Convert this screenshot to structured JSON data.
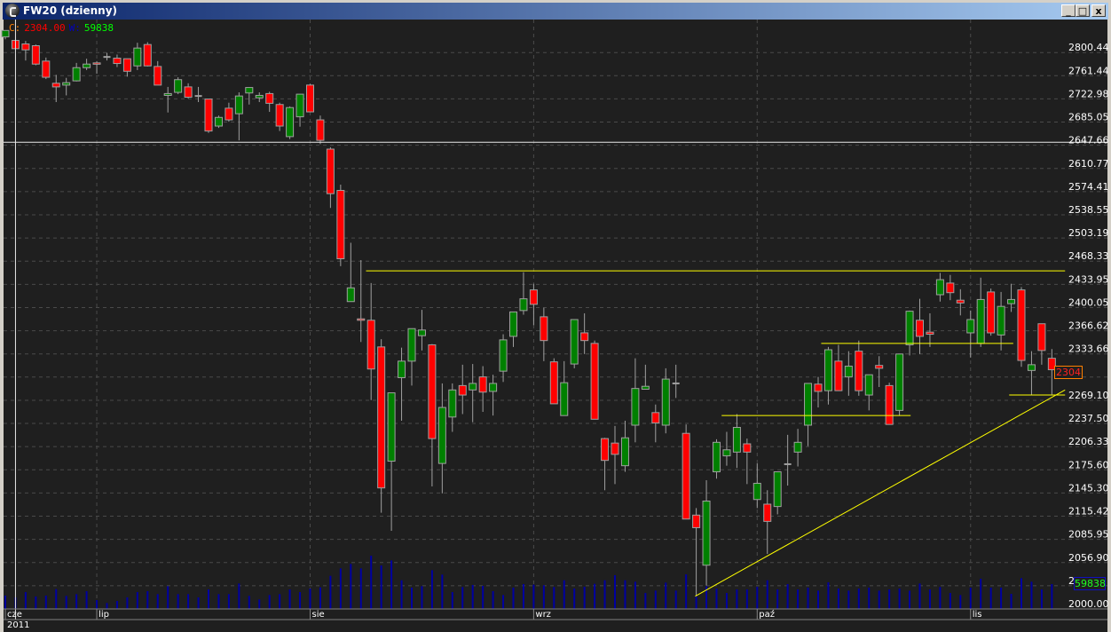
{
  "window": {
    "title": "FW20 (dzienny)",
    "minimize": "_",
    "maximize": "□",
    "close": "x"
  },
  "legend": {
    "c_label": "C:",
    "close": "2304.00",
    "w_label": "W:",
    "volume": "59838"
  },
  "tags": {
    "price": "2304",
    "volume": "59838"
  },
  "colors": {
    "up": "#008000",
    "down": "#ff0000",
    "doji": "#a0a0a0",
    "volume": "#0000a0",
    "annotation": "#ffff00",
    "legend_c": "#ff8000",
    "legend_close": "#ff0000",
    "legend_w": "#0000c0",
    "legend_volume": "#00ff00"
  },
  "x_axis": {
    "year": "2011",
    "months": [
      {
        "label": "cze",
        "index": 0
      },
      {
        "label": "lip",
        "index": 9
      },
      {
        "label": "sie",
        "index": 30
      },
      {
        "label": "wrz",
        "index": 52
      },
      {
        "label": "paź",
        "index": 74
      },
      {
        "label": "lis",
        "index": 95
      }
    ]
  },
  "chart_data": {
    "type": "candlestick",
    "title": "FW20 (dzienny)",
    "y_scale": "log",
    "ylim": [
      2000,
      2800.44
    ],
    "grid": true,
    "y_ticks": [
      {
        "label": "2800.44",
        "value": 2800.44
      },
      {
        "label": "2761.44",
        "value": 2761.44
      },
      {
        "label": "2722.98",
        "value": 2722.98
      },
      {
        "label": "2685.05",
        "value": 2685.05
      },
      {
        "label": "2647.66",
        "value": 2647.66
      },
      {
        "label": "2610.77",
        "value": 2610.77
      },
      {
        "label": "2574.41",
        "value": 2574.41
      },
      {
        "label": "2538.55",
        "value": 2538.55
      },
      {
        "label": "2503.19",
        "value": 2503.19
      },
      {
        "label": "2468.33",
        "value": 2468.33
      },
      {
        "label": "2433.95",
        "value": 2433.95
      },
      {
        "label": "2400.05",
        "value": 2400.05
      },
      {
        "label": "2366.62",
        "value": 2366.62
      },
      {
        "label": "2333.66",
        "value": 2333.66
      },
      {
        "label": "23",
        "value": 2301.2
      },
      {
        "label": "2269.10",
        "value": 2269.1
      },
      {
        "label": "2237.50",
        "value": 2237.5
      },
      {
        "label": "2206.33",
        "value": 2206.33
      },
      {
        "label": "2175.60",
        "value": 2175.6
      },
      {
        "label": "2145.30",
        "value": 2145.3
      },
      {
        "label": "2115.42",
        "value": 2115.42
      },
      {
        "label": "2085.95",
        "value": 2085.95
      },
      {
        "label": "2056.90",
        "value": 2056.9
      },
      {
        "label": "20",
        "value": 2028.3
      },
      {
        "label": "2000.00",
        "value": 2000.0
      }
    ],
    "candles_ohlc": [
      [
        2818,
        2829,
        2814,
        2829
      ],
      [
        2812,
        2812,
        2796,
        2798
      ],
      [
        2806,
        2811,
        2778,
        2796
      ],
      [
        2803,
        2805,
        2770,
        2772
      ],
      [
        2777,
        2783,
        2747,
        2750
      ],
      [
        2740,
        2754,
        2709,
        2734
      ],
      [
        2737,
        2749,
        2720,
        2741
      ],
      [
        2744,
        2774,
        2743,
        2766
      ],
      [
        2766,
        2781,
        2762,
        2772
      ],
      [
        2774,
        2777,
        2756,
        2773
      ],
      [
        2784,
        2791,
        2778,
        2784
      ],
      [
        2782,
        2788,
        2767,
        2773
      ],
      [
        2781,
        2781,
        2751,
        2760
      ],
      [
        2769,
        2808,
        2762,
        2799
      ],
      [
        2805,
        2809,
        2768,
        2769
      ],
      [
        2768,
        2777,
        2737,
        2737
      ],
      [
        2720,
        2734,
        2692,
        2723
      ],
      [
        2725,
        2750,
        2722,
        2746
      ],
      [
        2734,
        2740,
        2715,
        2717
      ],
      [
        2719,
        2734,
        2709,
        2719
      ],
      [
        2714,
        2714,
        2659,
        2662
      ],
      [
        2670,
        2687,
        2667,
        2684
      ],
      [
        2699,
        2708,
        2677,
        2680
      ],
      [
        2690,
        2725,
        2647,
        2719
      ],
      [
        2724,
        2733,
        2705,
        2733
      ],
      [
        2716,
        2725,
        2709,
        2720
      ],
      [
        2723,
        2726,
        2693,
        2707
      ],
      [
        2705,
        2708,
        2662,
        2670
      ],
      [
        2653,
        2702,
        2649,
        2700
      ],
      [
        2685,
        2722,
        2669,
        2722
      ],
      [
        2737,
        2739,
        2693,
        2693
      ],
      [
        2680,
        2687,
        2641,
        2647
      ],
      [
        2633,
        2636,
        2541,
        2563
      ],
      [
        2568,
        2577,
        2453,
        2464
      ],
      [
        2401,
        2488,
        2401,
        2421
      ],
      [
        2376,
        2462,
        2343,
        2374
      ],
      [
        2374,
        2428,
        2262,
        2305
      ],
      [
        2336,
        2347,
        2113,
        2145
      ],
      [
        2180,
        2272,
        2090,
        2272
      ],
      [
        2293,
        2335,
        2234,
        2316
      ],
      [
        2316,
        2362,
        2282,
        2362
      ],
      [
        2352,
        2389,
        2331,
        2360
      ],
      [
        2339,
        2340,
        2147,
        2210
      ],
      [
        2177,
        2285,
        2138,
        2252
      ],
      [
        2239,
        2285,
        2219,
        2276
      ],
      [
        2282,
        2311,
        2243,
        2269
      ],
      [
        2276,
        2312,
        2232,
        2285
      ],
      [
        2294,
        2309,
        2246,
        2273
      ],
      [
        2274,
        2297,
        2241,
        2285
      ],
      [
        2302,
        2354,
        2287,
        2346
      ],
      [
        2351,
        2386,
        2336,
        2386
      ],
      [
        2388,
        2444,
        2382,
        2405
      ],
      [
        2418,
        2427,
        2367,
        2397
      ],
      [
        2379,
        2392,
        2316,
        2345
      ],
      [
        2315,
        2320,
        2257,
        2257
      ],
      [
        2241,
        2316,
        2241,
        2286
      ],
      [
        2312,
        2375,
        2306,
        2375
      ],
      [
        2356,
        2384,
        2326,
        2345
      ],
      [
        2341,
        2345,
        2236,
        2236
      ],
      [
        2210,
        2211,
        2142,
        2181
      ],
      [
        2204,
        2227,
        2150,
        2189
      ],
      [
        2174,
        2234,
        2166,
        2211
      ],
      [
        2228,
        2320,
        2205,
        2278
      ],
      [
        2277,
        2311,
        2277,
        2281
      ],
      [
        2245,
        2256,
        2205,
        2231
      ],
      [
        2228,
        2306,
        2217,
        2291
      ],
      [
        2285,
        2311,
        2265,
        2285
      ],
      [
        2217,
        2229,
        2105,
        2105
      ],
      [
        2110,
        2119,
        2009,
        2094
      ],
      [
        2047,
        2155,
        2022,
        2128
      ],
      [
        2166,
        2209,
        2157,
        2205
      ],
      [
        2187,
        2219,
        2174,
        2195
      ],
      [
        2192,
        2243,
        2171,
        2225
      ],
      [
        2203,
        2210,
        2150,
        2192
      ],
      [
        2130,
        2177,
        2119,
        2151
      ],
      [
        2124,
        2142,
        2061,
        2102
      ],
      [
        2121,
        2166,
        2111,
        2166
      ],
      [
        2176,
        2215,
        2148,
        2176
      ],
      [
        2192,
        2223,
        2173,
        2205
      ],
      [
        2228,
        2285,
        2200,
        2285
      ],
      [
        2284,
        2294,
        2252,
        2274
      ],
      [
        2275,
        2336,
        2256,
        2332
      ],
      [
        2316,
        2339,
        2275,
        2275
      ],
      [
        2294,
        2330,
        2268,
        2309
      ],
      [
        2330,
        2345,
        2268,
        2275
      ],
      [
        2269,
        2297,
        2248,
        2297
      ],
      [
        2310,
        2323,
        2280,
        2306
      ],
      [
        2282,
        2286,
        2229,
        2229
      ],
      [
        2248,
        2326,
        2241,
        2326
      ],
      [
        2339,
        2388,
        2324,
        2387
      ],
      [
        2374,
        2405,
        2326,
        2351
      ],
      [
        2357,
        2384,
        2336,
        2354
      ],
      [
        2411,
        2443,
        2401,
        2433
      ],
      [
        2428,
        2440,
        2403,
        2414
      ],
      [
        2403,
        2419,
        2381,
        2399
      ],
      [
        2356,
        2388,
        2321,
        2375
      ],
      [
        2341,
        2436,
        2336,
        2404
      ],
      [
        2415,
        2420,
        2352,
        2356
      ],
      [
        2353,
        2415,
        2331,
        2394
      ],
      [
        2398,
        2427,
        2386,
        2404
      ],
      [
        2418,
        2422,
        2308,
        2317
      ],
      [
        2303,
        2330,
        2269,
        2311
      ],
      [
        2369,
        2369,
        2311,
        2331
      ],
      [
        2320,
        2333,
        2269,
        2304
      ]
    ],
    "volume": [
      32040,
      27768,
      40584,
      29904,
      32040,
      47704,
      31328,
      35600,
      42720,
      21360,
      14240,
      19224,
      27768,
      40584,
      42720,
      35600,
      54824,
      35600,
      35600,
      27768,
      46992,
      35600,
      35600,
      61232,
      31328,
      22784,
      33464,
      35600,
      46992,
      40584,
      49128,
      51976,
      79744,
      97544,
      108224,
      97544,
      128160,
      104664,
      116768,
      69064,
      51264,
      54824,
      93272,
      82592,
      40584,
      52688,
      57672,
      55536,
      42720,
      33464,
      51264,
      59808,
      58384,
      56960,
      52688,
      69064,
      49128,
      53400,
      60520,
      69064,
      81168,
      69064,
      65504,
      38448,
      44144,
      63368,
      44144,
      83304,
      29904,
      54824,
      49128,
      38448,
      46992,
      46992,
      53400,
      69064,
      46992,
      59808,
      46992,
      51264,
      44144,
      64080,
      49128,
      44144,
      49128,
      51264,
      44144,
      46992,
      49128,
      44144,
      61232,
      46992,
      52688,
      38448,
      33464,
      51264,
      72624,
      51264,
      51264,
      36312,
      74048,
      65504,
      46992,
      59838
    ],
    "annotations": [
      {
        "type": "horizontal",
        "price": 2446,
        "from_index": 35.5,
        "to_index": 104.3
      },
      {
        "type": "horizontal",
        "price": 2341,
        "from_index": 80.3,
        "to_index": 99.2
      },
      {
        "type": "horizontal",
        "price": 2241,
        "from_index": 70.5,
        "to_index": 89.1
      },
      {
        "type": "horizontal",
        "price": 2269,
        "from_index": 98.8,
        "to_index": 104.3
      },
      {
        "type": "trendline",
        "from_index": 67.9,
        "from_price": 2009,
        "to_index": 104.3,
        "to_price": 2276
      }
    ],
    "crosshair": {
      "index": 1,
      "price": 2644
    }
  }
}
